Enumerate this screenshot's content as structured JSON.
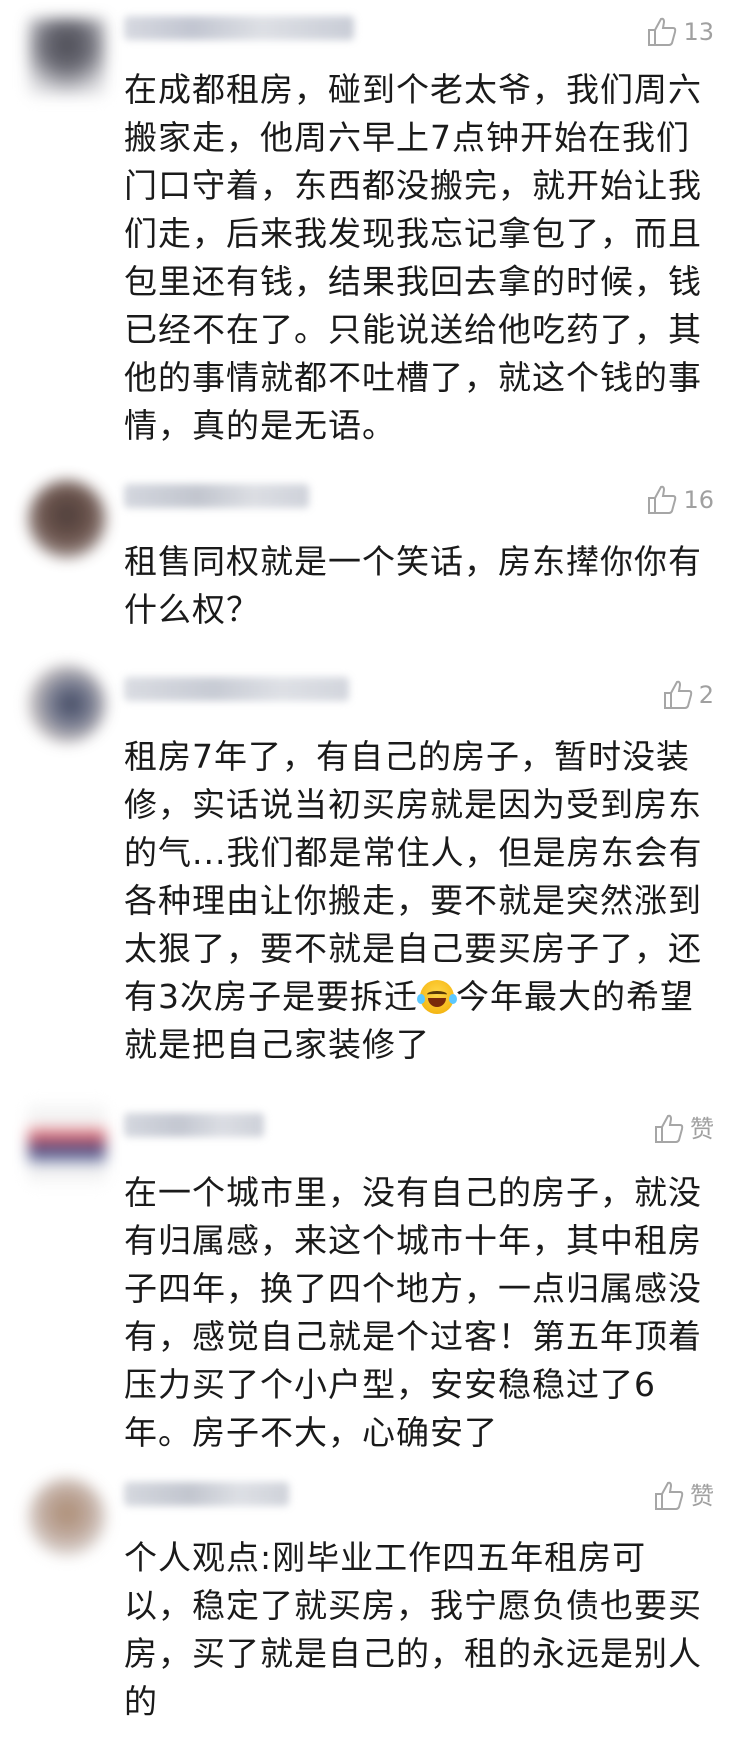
{
  "comments": [
    {
      "likes": "13",
      "text": "在成都租房，碰到个老太爷，我们周六\n搬家走，他周六早上7点钟开始在我们\n门口守着，东西都没搬完，就开始让我\n们走，后来我发现我忘记拿包了，而且\n包里还有钱，结果我回去拿的时候，钱\n已经不在了。只能说送给他吃药了，其\n他的事情就都不吐槽了，就这个钱的事\n情，真的是无语。"
    },
    {
      "likes": "16",
      "text": "租售同权就是一个笑话，房东撵你你有\n什么权？"
    },
    {
      "likes": "2",
      "text_before_emoji": "租房7年了，有自己的房子，暂时没装\n修，实话说当初买房就是因为受到房东\n的气...我们都是常住人，但是房东会有\n各种理由让你搬走，要不就是突然涨到\n太狠了，要不就是自己要买房子了，还\n有3次房子是要拆迁",
      "emoji_icon": "laugh-cry-emoji",
      "text_after_emoji": "今年最大的希望\n就是把自己家装修了"
    },
    {
      "likes": "赞",
      "text": "在一个城市里，没有自己的房子，就没\n有归属感，来这个城市十年，其中租房\n子四年，换了四个地方，一点归属感没\n有，感觉自己就是个过客！第五年顶着\n压力买了个小户型，安安稳稳过了6\n年。房子不大，心确安了"
    },
    {
      "likes": "赞",
      "text": "个人观点:刚毕业工作四五年租房可\n以，稳定了就买房，我宁愿负债也要买\n房，买了就是自己的，租的永远是别人\n的"
    }
  ],
  "like_icon": "thumbs-up-icon",
  "colors": {
    "text": "#1a1a1a",
    "meta": "#a0a0a0",
    "background": "#ffffff"
  }
}
